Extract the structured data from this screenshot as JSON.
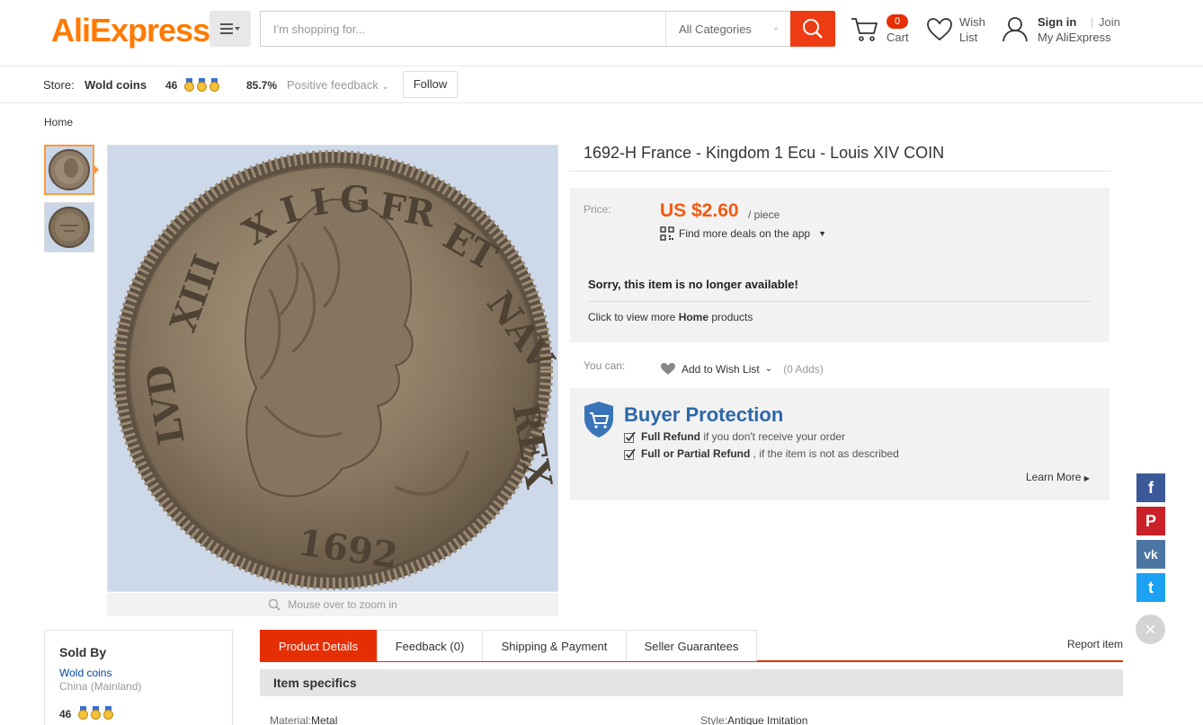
{
  "header": {
    "logo": "AliExpress",
    "logo_tm": "™",
    "search_placeholder": "I'm shopping for...",
    "search_category": "All Categories",
    "cart_count": "0",
    "cart_label": "Cart",
    "wish_label_1": "Wish",
    "wish_label_2": "List",
    "sign_in": "Sign in",
    "separator": "|",
    "join": "Join",
    "my_aliexpress": "My AliExpress"
  },
  "store": {
    "label": "Store:",
    "name": "Wold coins",
    "score": "46",
    "positive_pct": "85.7%",
    "feedback_label": "Positive feedback",
    "follow_label": "Follow"
  },
  "breadcrumb": "Home",
  "gallery": {
    "zoom_hint": "Mouse over to zoom in",
    "coin_year": "1692"
  },
  "product": {
    "title": "1692-H France - Kingdom 1 Ecu - Louis XIV COIN",
    "price_label": "Price:",
    "price": "US $2.60",
    "per": "/ piece",
    "app_deals": "Find more deals on the app",
    "unavailable": "Sorry, this item is no longer available!",
    "more_prefix": "Click to view more ",
    "more_bold": "Home",
    "more_suffix": " products",
    "you_can": "You can:",
    "add_wish": "Add to Wish List",
    "adds": "(0 Adds)"
  },
  "buyer_protection": {
    "title": "Buyer Protection",
    "row1_bold": "Full Refund",
    "row1_text": " if you don't receive your order",
    "row2_bold": "Full or Partial Refund",
    "row2_text": " , if the item is not as described",
    "learn_more": "Learn More"
  },
  "social": {
    "facebook": "f",
    "pinterest": "P",
    "vk": "vk",
    "twitter": "t",
    "colors": {
      "facebook": "#3b5998",
      "pinterest": "#cb2027",
      "vk": "#4c75a3",
      "twitter": "#1da1f2"
    }
  },
  "sold_by": {
    "heading": "Sold By",
    "store": "Wold coins",
    "location": "China (Mainland)",
    "score": "46"
  },
  "tabs": [
    {
      "label": "Product Details"
    },
    {
      "label": "Feedback (0)"
    },
    {
      "label": "Shipping & Payment"
    },
    {
      "label": "Seller Guarantees"
    }
  ],
  "report_item": "Report item",
  "specifics": {
    "heading": "Item specifics",
    "material_label": "Material:",
    "material_value": "Metal",
    "style_label": "Style:",
    "style_value": "Antique Imitation"
  },
  "colors": {
    "accent": "#e62e04",
    "price": "#f05a0f",
    "brand": "#ff7a00",
    "protection": "#2c67a8"
  }
}
